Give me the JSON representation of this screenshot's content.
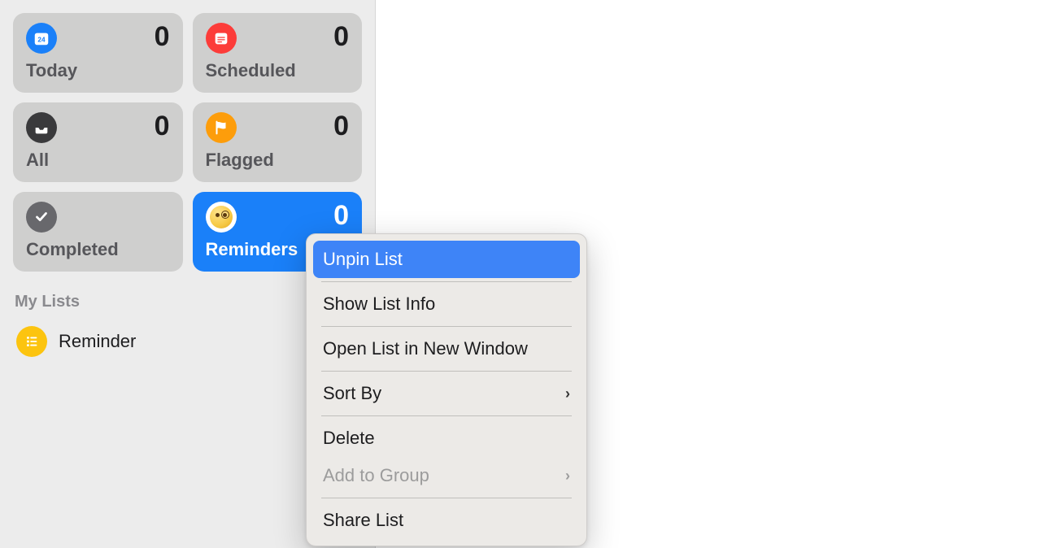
{
  "sidebar": {
    "cards": {
      "today": {
        "label": "Today",
        "count": "0",
        "icon_bg": "#1a80f9",
        "icon_name": "calendar-today-icon"
      },
      "scheduled": {
        "label": "Scheduled",
        "count": "0",
        "icon_bg": "#fc3c39",
        "icon_name": "calendar-icon"
      },
      "all": {
        "label": "All",
        "count": "0",
        "icon_bg": "#3a3a3c",
        "icon_name": "tray-icon"
      },
      "flagged": {
        "label": "Flagged",
        "count": "0",
        "icon_bg": "#fd9d0b",
        "icon_name": "flag-icon"
      },
      "completed": {
        "label": "Completed",
        "icon_bg": "#68686c",
        "icon_name": "checkmark-icon"
      },
      "reminders": {
        "label": "Reminders",
        "count": "0",
        "icon_bg": "#ffffff",
        "icon_name": "emoji-monocle-icon",
        "selected": true
      }
    },
    "my_lists_header": "My Lists",
    "lists": [
      {
        "label": "Reminder",
        "icon_bg": "#fcc40f",
        "icon_name": "list-bullets-icon"
      }
    ]
  },
  "context_menu": {
    "items": [
      {
        "label": "Unpin List",
        "highlighted": true
      },
      {
        "separator": true
      },
      {
        "label": "Show List Info"
      },
      {
        "separator": true
      },
      {
        "label": "Open List in New Window"
      },
      {
        "separator": true
      },
      {
        "label": "Sort By",
        "submenu": true
      },
      {
        "separator": true
      },
      {
        "label": "Delete"
      },
      {
        "label": "Add to Group",
        "disabled": true,
        "submenu": true
      },
      {
        "separator": true
      },
      {
        "label": "Share List"
      }
    ]
  }
}
